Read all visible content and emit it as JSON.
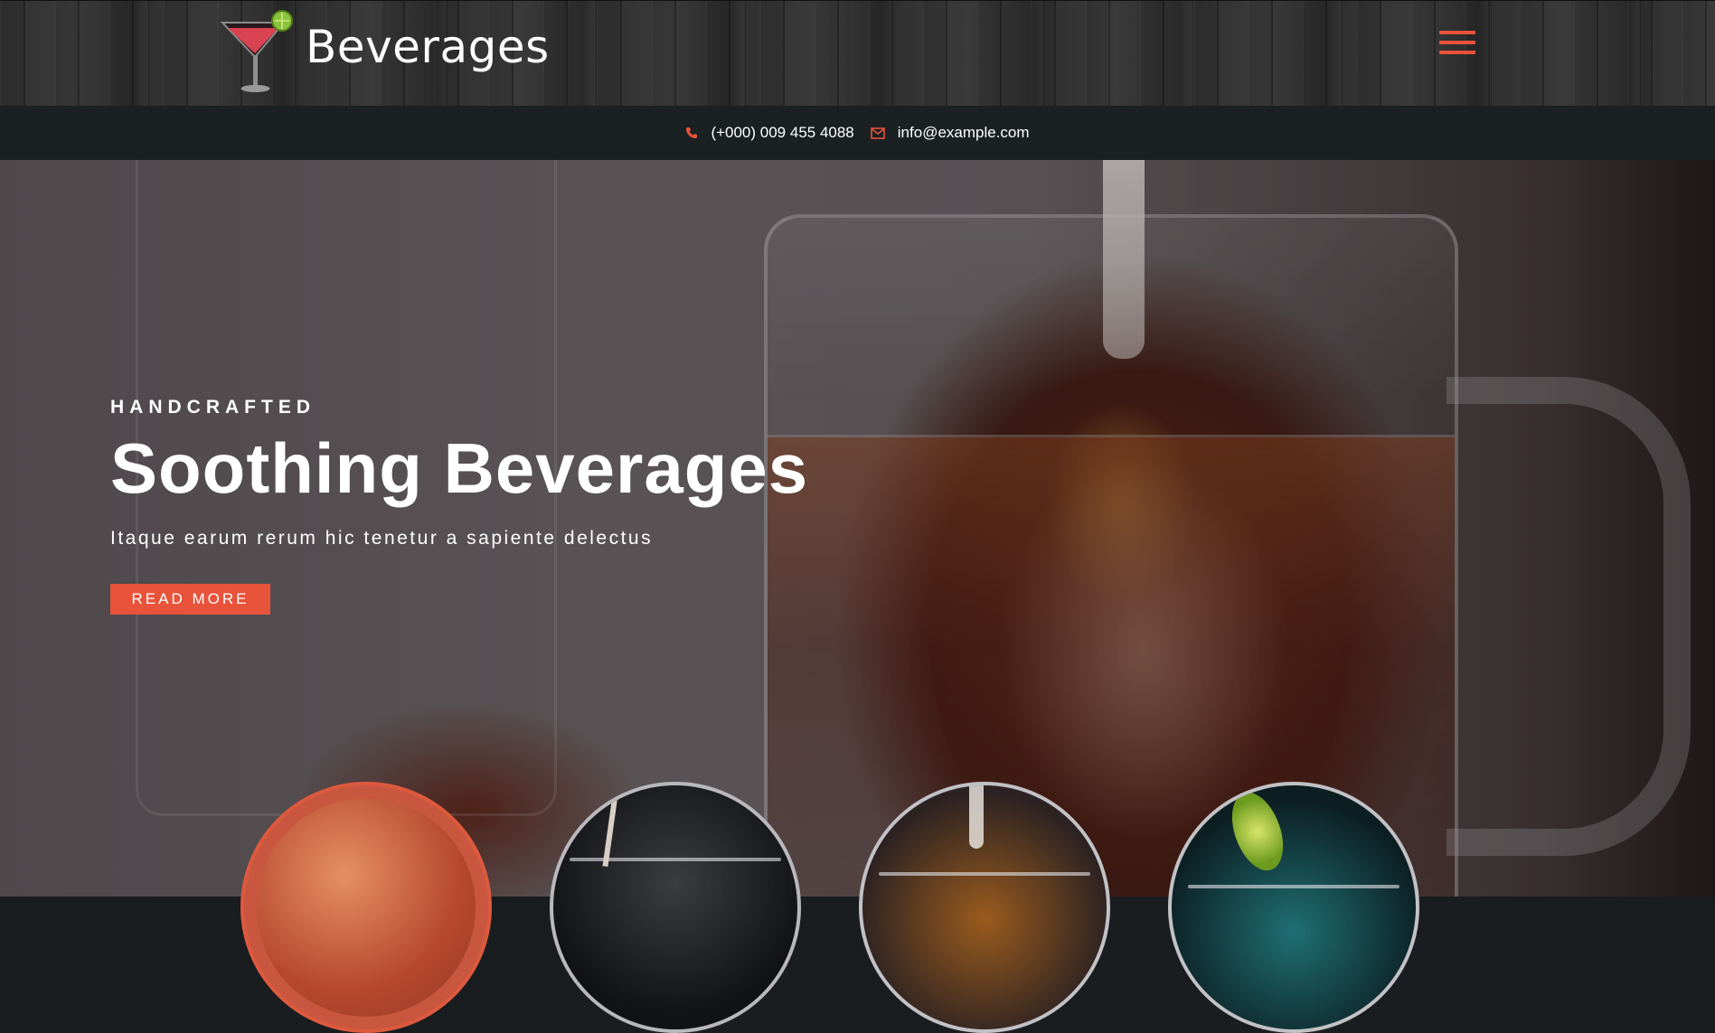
{
  "brand": {
    "name": "Beverages",
    "logo_icon": "cocktail-glass-icon"
  },
  "nav": {
    "menu_icon": "hamburger-menu-icon"
  },
  "contact": {
    "phone_icon": "phone-icon",
    "phone": "(+000) 009 455 4088",
    "email_icon": "envelope-icon",
    "email": "info@example.com"
  },
  "hero": {
    "kicker": "HANDCRAFTED",
    "title": "Soothing Beverages",
    "subtitle": "Itaque earum rerum hic tenetur a sapiente delectus",
    "cta_label": "READ MORE"
  },
  "featured_drinks": [
    {
      "image": "drink-thumbnail-1",
      "highlighted": true
    },
    {
      "image": "drink-thumbnail-2",
      "highlighted": false
    },
    {
      "image": "drink-thumbnail-3",
      "highlighted": false
    },
    {
      "image": "drink-thumbnail-4",
      "highlighted": false
    }
  ],
  "colors": {
    "accent": "#e8533a",
    "contact_bar": "#1b2123",
    "text": "#ffffff"
  }
}
